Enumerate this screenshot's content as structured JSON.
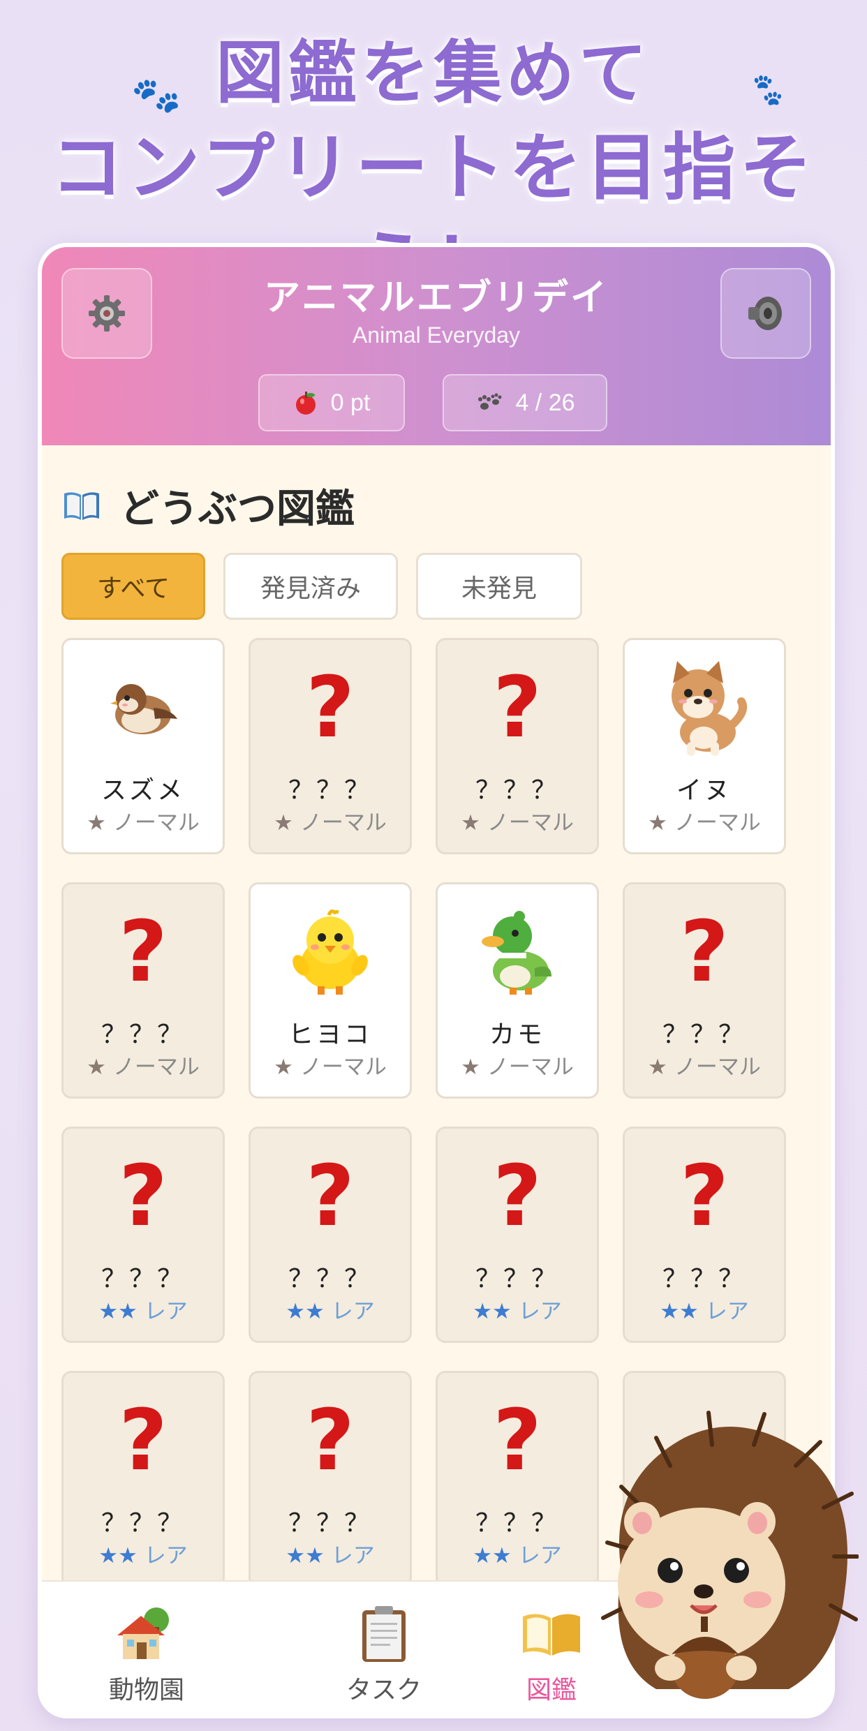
{
  "promo": {
    "line1": "図鑑を集めて",
    "line2": "コンプリートを目指そう！"
  },
  "app": {
    "title": "アニマルエブリデイ",
    "subtitle": "Animal Everyday",
    "points": "0 pt",
    "collection_count": "4 / 26",
    "settings_icon": "gear-icon",
    "sound_icon": "speaker-icon"
  },
  "book": {
    "section_title": "どうぶつ図鑑",
    "filters": [
      "すべて",
      "発見済み",
      "未発見"
    ],
    "active_filter": "すべて"
  },
  "cards": [
    {
      "name": "スズメ",
      "found": true,
      "icon": "sparrow",
      "stars": "★",
      "rarity": "ノーマル"
    },
    {
      "name": "？？？",
      "found": false,
      "stars": "★",
      "rarity": "ノーマル"
    },
    {
      "name": "？？？",
      "found": false,
      "stars": "★",
      "rarity": "ノーマル"
    },
    {
      "name": "イヌ",
      "found": true,
      "icon": "dog",
      "stars": "★",
      "rarity": "ノーマル"
    },
    {
      "name": "？？？",
      "found": false,
      "stars": "★",
      "rarity": "ノーマル"
    },
    {
      "name": "ヒヨコ",
      "found": true,
      "icon": "chick",
      "stars": "★",
      "rarity": "ノーマル"
    },
    {
      "name": "カモ",
      "found": true,
      "icon": "duck",
      "stars": "★",
      "rarity": "ノーマル"
    },
    {
      "name": "？？？",
      "found": false,
      "stars": "★",
      "rarity": "ノーマル"
    },
    {
      "name": "？？？",
      "found": false,
      "stars": "★★",
      "rarity": "レア"
    },
    {
      "name": "？？？",
      "found": false,
      "stars": "★★",
      "rarity": "レア"
    },
    {
      "name": "？？？",
      "found": false,
      "stars": "★★",
      "rarity": "レア"
    },
    {
      "name": "？？？",
      "found": false,
      "stars": "★★",
      "rarity": "レア"
    },
    {
      "name": "？？？",
      "found": false,
      "stars": "★★",
      "rarity": "レア"
    },
    {
      "name": "？？？",
      "found": false,
      "stars": "★★",
      "rarity": "レア"
    },
    {
      "name": "？？？",
      "found": false,
      "stars": "★★",
      "rarity": "レア"
    },
    {
      "name": "",
      "found": false,
      "stars": "",
      "rarity": ""
    }
  ],
  "unknown_mark": "?",
  "nav": {
    "zoo": "動物園",
    "task": "タスク",
    "book": "図鑑",
    "active": "図鑑"
  },
  "colors": {
    "accent_pink": "#e9579c",
    "filter_active": "#f2b43c",
    "header_gradient_start": "#f088b8",
    "header_gradient_end": "#ad8bd6",
    "unknown_mark": "#d41717",
    "rare_star": "#3d7cd1"
  }
}
